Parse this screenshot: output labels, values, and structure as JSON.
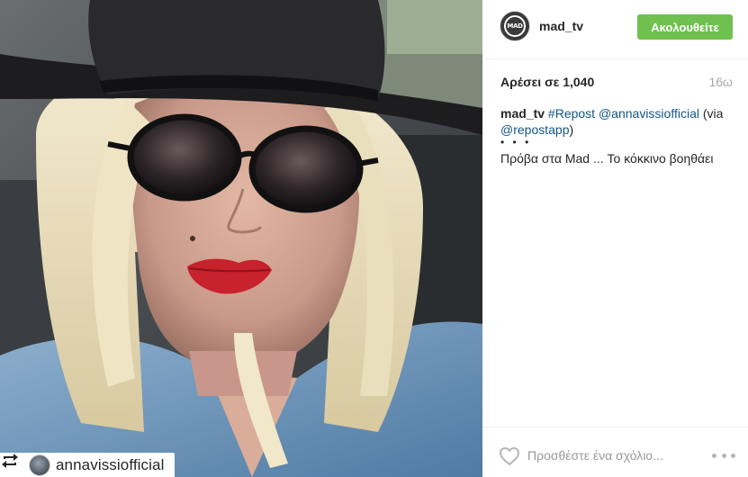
{
  "post": {
    "photo": {
      "description_icon": "photo",
      "repost_tag": {
        "icon": "repost-icon",
        "username": "annavissiofficial"
      }
    }
  },
  "header": {
    "avatar_text": "MAD",
    "username": "mad_tv",
    "follow_label": "Ακολουθείτε"
  },
  "stats": {
    "likes": "Αρέσει σε 1,040",
    "timestamp": "16ω"
  },
  "caption": {
    "username": "mad_tv",
    "hashtag": "#Repost",
    "mention": "@annavissiofficial",
    "via_open": "(via",
    "via_mention": "@repostapp",
    "via_close": ")",
    "dots": "• • •",
    "text": "Πρόβα στα Mad ... Το κόκκινο βοηθάει"
  },
  "footer": {
    "comment_placeholder": "Προσθέστε ένα σχόλιο...",
    "like_icon": "heart-icon",
    "more_icon": "more-options-icon"
  },
  "colors": {
    "follow_button": "#70c050",
    "link": "#125688",
    "muted": "#a5a7aa"
  }
}
